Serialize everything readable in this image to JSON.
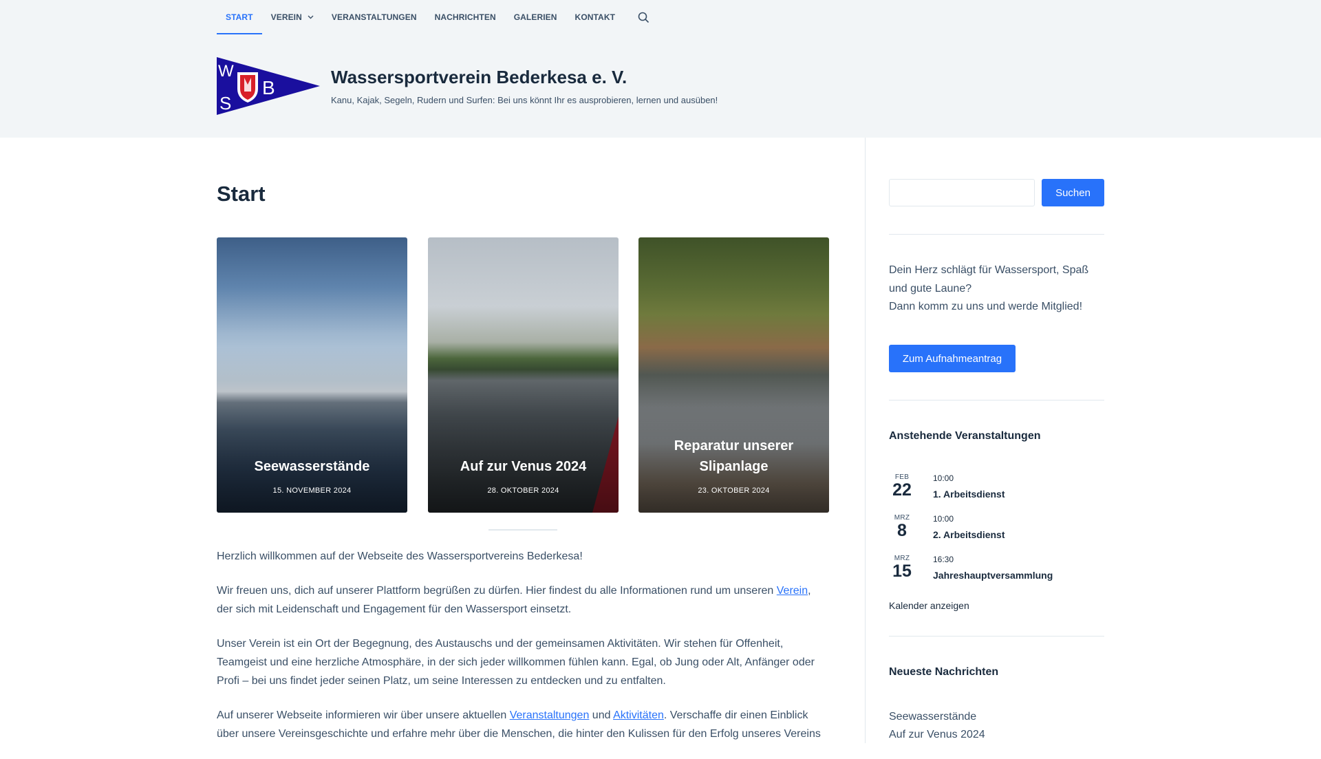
{
  "nav": {
    "items": [
      {
        "label": "START"
      },
      {
        "label": "VEREIN"
      },
      {
        "label": "VERANSTALTUNGEN"
      },
      {
        "label": "NACHRICHTEN"
      },
      {
        "label": "GALERIEN"
      },
      {
        "label": "KONTAKT"
      }
    ],
    "search_icon": "search-icon",
    "dropdown_icon": "chevron-down-icon"
  },
  "site": {
    "title": "Wassersportverein Bederkesa e. V.",
    "tagline": "Kanu, Kajak, Segeln, Rudern und Surfen: Bei uns könnt Ihr es ausprobieren, lernen und ausüben!",
    "logo_letters": [
      "W",
      "S",
      "B"
    ]
  },
  "main": {
    "page_title": "Start",
    "cards": [
      {
        "title": "Seewasserstände",
        "date": "15. NOVEMBER 2024"
      },
      {
        "title": "Auf zur Venus 2024",
        "date": "28. OKTOBER 2024"
      },
      {
        "title": "Reparatur unserer Slipanlage",
        "date": "23. OKTOBER 2024"
      }
    ],
    "p1": "Herzlich willkommen auf der Webseite des Wassersportvereins Bederkesa!",
    "p2_a": "Wir freuen uns, dich auf unserer Plattform begrüßen zu dürfen. Hier findest du alle Informationen rund um unseren ",
    "p2_link": "Verein",
    "p2_b": ", der sich mit Leidenschaft und Engagement für den Wassersport einsetzt.",
    "p3": "Unser Verein ist ein Ort der Begegnung, des Austauschs und der gemeinsamen Aktivitäten. Wir stehen für Offenheit, Teamgeist und eine herzliche Atmosphäre, in der sich jeder willkommen fühlen kann. Egal, ob Jung oder Alt, Anfänger oder Profi – bei uns findet jeder seinen Platz, um seine Interessen zu entdecken und zu entfalten.",
    "p4_a": "Auf unserer Webseite informieren wir über unsere aktuellen ",
    "p4_link1": "Veranstaltungen",
    "p4_b": " und ",
    "p4_link2": "Aktivitäten",
    "p4_c": ". Verschaffe dir einen Einblick über unsere Vereinsgeschichte und erfahre mehr über die Menschen, die hinter den Kulissen für den Erfolg unseres Vereins"
  },
  "sidebar": {
    "search_placeholder": "",
    "search_button": "Suchen",
    "intro_line1": "Dein Herz schlägt für Wassersport, Spaß und gute Laune?",
    "intro_line2": "Dann komm zu uns und werde Mitglied!",
    "join_button": "Zum Aufnahmeantrag",
    "events_heading": "Anstehende Veranstaltungen",
    "events": [
      {
        "month": "FEB",
        "day": "22",
        "time": "10:00",
        "title": "1. Arbeitsdienst"
      },
      {
        "month": "MRZ",
        "day": "8",
        "time": "10:00",
        "title": "2. Arbeitsdienst"
      },
      {
        "month": "MRZ",
        "day": "15",
        "time": "16:30",
        "title": "Jahreshauptversammlung"
      }
    ],
    "calendar_link": "Kalender anzeigen",
    "news_heading": "Neueste Nachrichten",
    "news": [
      "Seewasserstände",
      "Auf zur Venus 2024"
    ]
  },
  "colors": {
    "accent": "#2872fa",
    "heading": "#192a3d",
    "text": "#3a4f66",
    "header_bg": "#f2f5f7",
    "logo_blue": "#1a0f9e",
    "logo_red": "#d8202a"
  }
}
